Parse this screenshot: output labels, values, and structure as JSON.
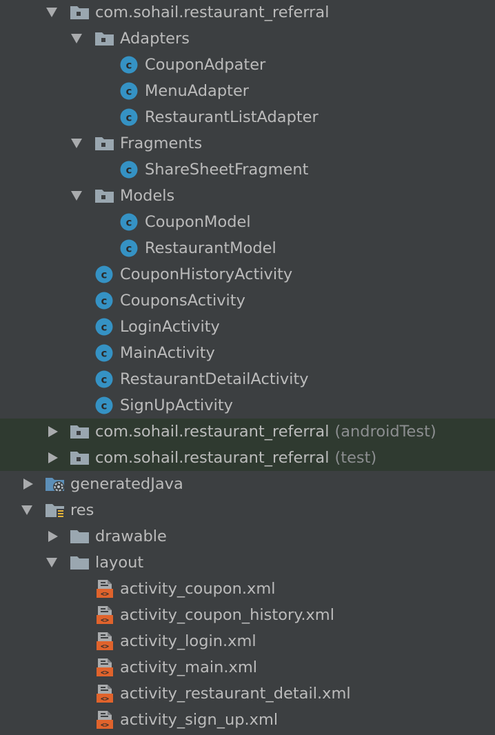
{
  "colors": {
    "background": "#3c3f41",
    "text": "#bbbbbb",
    "dim_text": "#8c8e90",
    "highlight_row": "#2f3a30",
    "folder": "#9aa7b0",
    "class_icon": "#3592c4",
    "xml_icon": "#e0632c"
  },
  "tree": {
    "rows": [
      {
        "label": "com.sohail.restaurant_referral",
        "icon": "package-folder-icon",
        "expanded": true
      },
      {
        "label": "Adapters",
        "icon": "package-folder-icon",
        "expanded": true
      },
      {
        "label": "CouponAdpater",
        "icon": "class-icon"
      },
      {
        "label": "MenuAdapter",
        "icon": "class-icon"
      },
      {
        "label": "RestaurantListAdapter",
        "icon": "class-icon"
      },
      {
        "label": "Fragments",
        "icon": "package-folder-icon",
        "expanded": true
      },
      {
        "label": "ShareSheetFragment",
        "icon": "class-icon"
      },
      {
        "label": "Models",
        "icon": "package-folder-icon",
        "expanded": true
      },
      {
        "label": "CouponModel",
        "icon": "class-icon"
      },
      {
        "label": "RestaurantModel",
        "icon": "class-icon"
      },
      {
        "label": "CouponHistoryActivity",
        "icon": "class-icon"
      },
      {
        "label": "CouponsActivity",
        "icon": "class-icon"
      },
      {
        "label": "LoginActivity",
        "icon": "class-icon"
      },
      {
        "label": "MainActivity",
        "icon": "class-icon"
      },
      {
        "label": "RestaurantDetailActivity",
        "icon": "class-icon"
      },
      {
        "label": "SignUpActivity",
        "icon": "class-icon"
      },
      {
        "label": "com.sohail.restaurant_referral",
        "suffix": "(androidTest)",
        "icon": "package-folder-icon",
        "expanded": false
      },
      {
        "label": "com.sohail.restaurant_referral",
        "suffix": "(test)",
        "icon": "package-folder-icon",
        "expanded": false
      },
      {
        "label": "generatedJava",
        "icon": "generated-java-folder-icon",
        "expanded": false
      },
      {
        "label": "res",
        "icon": "resources-folder-icon",
        "expanded": true
      },
      {
        "label": "drawable",
        "icon": "folder-icon",
        "expanded": false
      },
      {
        "label": "layout",
        "icon": "folder-icon",
        "expanded": true
      },
      {
        "label": "activity_coupon.xml",
        "icon": "layout-xml-icon"
      },
      {
        "label": "activity_coupon_history.xml",
        "icon": "layout-xml-icon"
      },
      {
        "label": "activity_login.xml",
        "icon": "layout-xml-icon"
      },
      {
        "label": "activity_main.xml",
        "icon": "layout-xml-icon"
      },
      {
        "label": "activity_restaurant_detail.xml",
        "icon": "layout-xml-icon"
      },
      {
        "label": "activity_sign_up.xml",
        "icon": "layout-xml-icon"
      }
    ]
  }
}
